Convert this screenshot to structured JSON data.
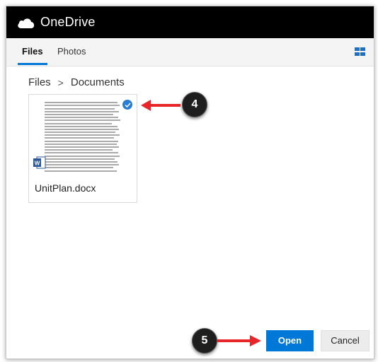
{
  "app": {
    "brand": "OneDrive"
  },
  "tabs": [
    {
      "label": "Files",
      "active": true
    },
    {
      "label": "Photos",
      "active": false
    }
  ],
  "breadcrumb": {
    "root": "Files",
    "separator": ">",
    "current": "Documents"
  },
  "file": {
    "name": "UnitPlan.docx",
    "selected": true,
    "type": "Word document"
  },
  "annotations": {
    "step_a": "4",
    "step_b": "5"
  },
  "buttons": {
    "open": "Open",
    "cancel": "Cancel"
  },
  "colors": {
    "accent": "#0078d7",
    "annotation_arrow": "#e8262a",
    "topbar": "#000000"
  }
}
